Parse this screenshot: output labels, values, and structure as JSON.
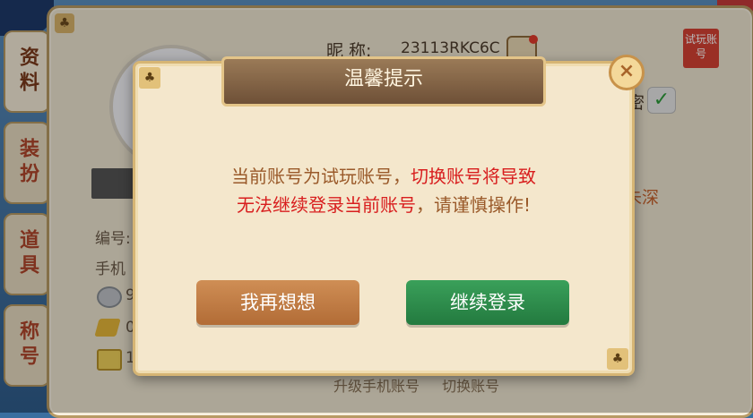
{
  "tabs": [
    {
      "label": "资料"
    },
    {
      "label": "装扮"
    },
    {
      "label": "道具"
    },
    {
      "label": "称号"
    }
  ],
  "profile": {
    "nickname_label": "昵  称:",
    "nickname_value": "23113RKC6C",
    "number_label": "编号:",
    "phone_label": "手机",
    "coin_value": "9",
    "gold_value": "0",
    "exchange_value": "1",
    "trial_badge": "试玩账号",
    "password_partial": "密",
    "status_partial": "未深"
  },
  "bottom_links": {
    "upgrade": "升级手机账号",
    "switch": "切换账号"
  },
  "dialog": {
    "title": "温馨提示",
    "close_label": "×",
    "line1_part1": "当前账号为试玩账号，",
    "line1_part2": "切换账号将导致",
    "line2_part1": "无法继续登录当前账号",
    "line2_part2": "，请谨慎操作!",
    "cancel_label": "我再想想",
    "confirm_label": "继续登录"
  },
  "colors": {
    "accent_red": "#d81e1e",
    "accent_green": "#237a3f",
    "accent_orange": "#b26c36"
  }
}
